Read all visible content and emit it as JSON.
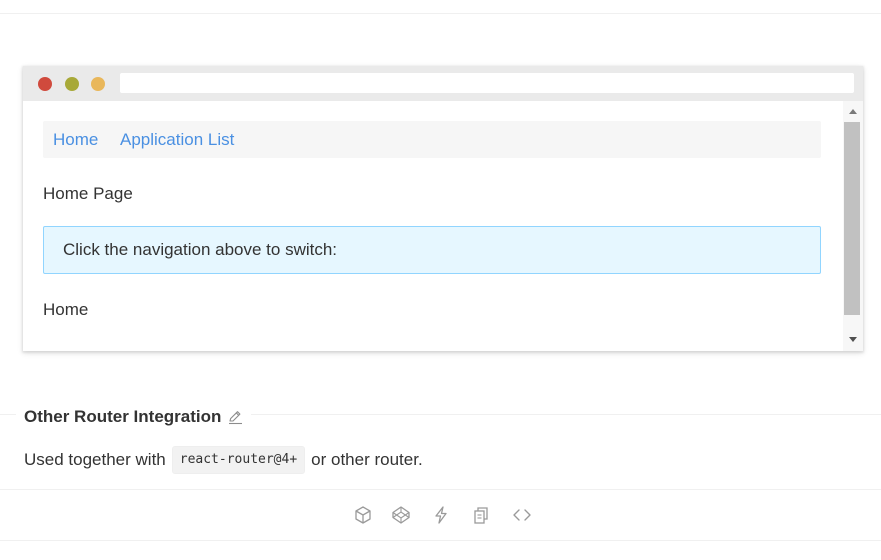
{
  "demo": {
    "nav": {
      "home_label": "Home",
      "apps_label": "Application List"
    },
    "page_title": "Home Page",
    "alert_text": "Click the navigation above to switch:",
    "route_output": "Home"
  },
  "section": {
    "title": "Other Router Integration",
    "edit_icon": "edit-icon",
    "description_before": "Used together with",
    "code": "react-router@4+",
    "description_after": "or other router."
  },
  "actions": {
    "icons": [
      "codesandbox-icon",
      "codepen-icon",
      "thunderbolt-icon",
      "copy-icon",
      "expand-code-icon"
    ]
  },
  "colors": {
    "link": "#4a90e2",
    "alert_bg": "#e6f7ff",
    "alert_border": "#91d5ff",
    "dot_red": "#d04a3d",
    "dot_olive": "#a8a938",
    "dot_amber": "#e9b75b"
  }
}
